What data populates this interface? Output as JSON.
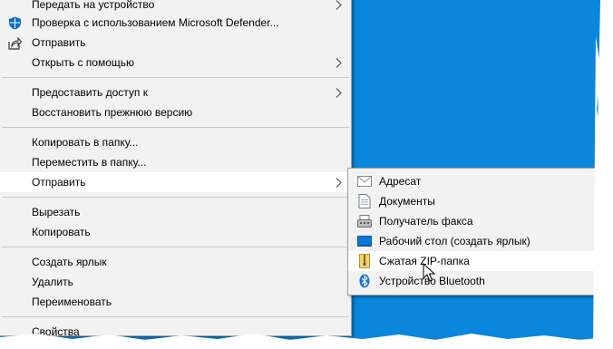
{
  "colors": {
    "desktop": "#0a86dc",
    "menu_bg": "#f2f2f2",
    "highlight": "#ffffff",
    "separator": "#c9c9c9"
  },
  "main_menu": {
    "send_to_device": "Передать на устройство",
    "defender_scan": "Проверка с использованием Microsoft Defender...",
    "share": "Отправить",
    "open_with": "Открыть с помощью",
    "give_access": "Предоставить доступ к",
    "restore_versions": "Восстановить прежнюю версию",
    "copy_to_folder": "Копировать в папку...",
    "move_to_folder": "Переместить в папку...",
    "send_to": "Отправить",
    "cut": "Вырезать",
    "copy": "Копировать",
    "create_shortcut": "Создать ярлык",
    "delete": "Удалить",
    "rename": "Переименовать",
    "properties": "Свойства"
  },
  "sub_menu": {
    "items": [
      {
        "label": "Адресат",
        "icon": "mail-recipient-icon"
      },
      {
        "label": "Документы",
        "icon": "documents-icon"
      },
      {
        "label": "Получатель факса",
        "icon": "fax-icon"
      },
      {
        "label": "Рабочий стол (создать ярлык)",
        "icon": "desktop-icon"
      },
      {
        "label": "Сжатая ZIP-папка",
        "icon": "zip-folder-icon"
      },
      {
        "label": "Устройство Bluetooth",
        "icon": "bluetooth-icon"
      }
    ],
    "active_index": 4
  }
}
